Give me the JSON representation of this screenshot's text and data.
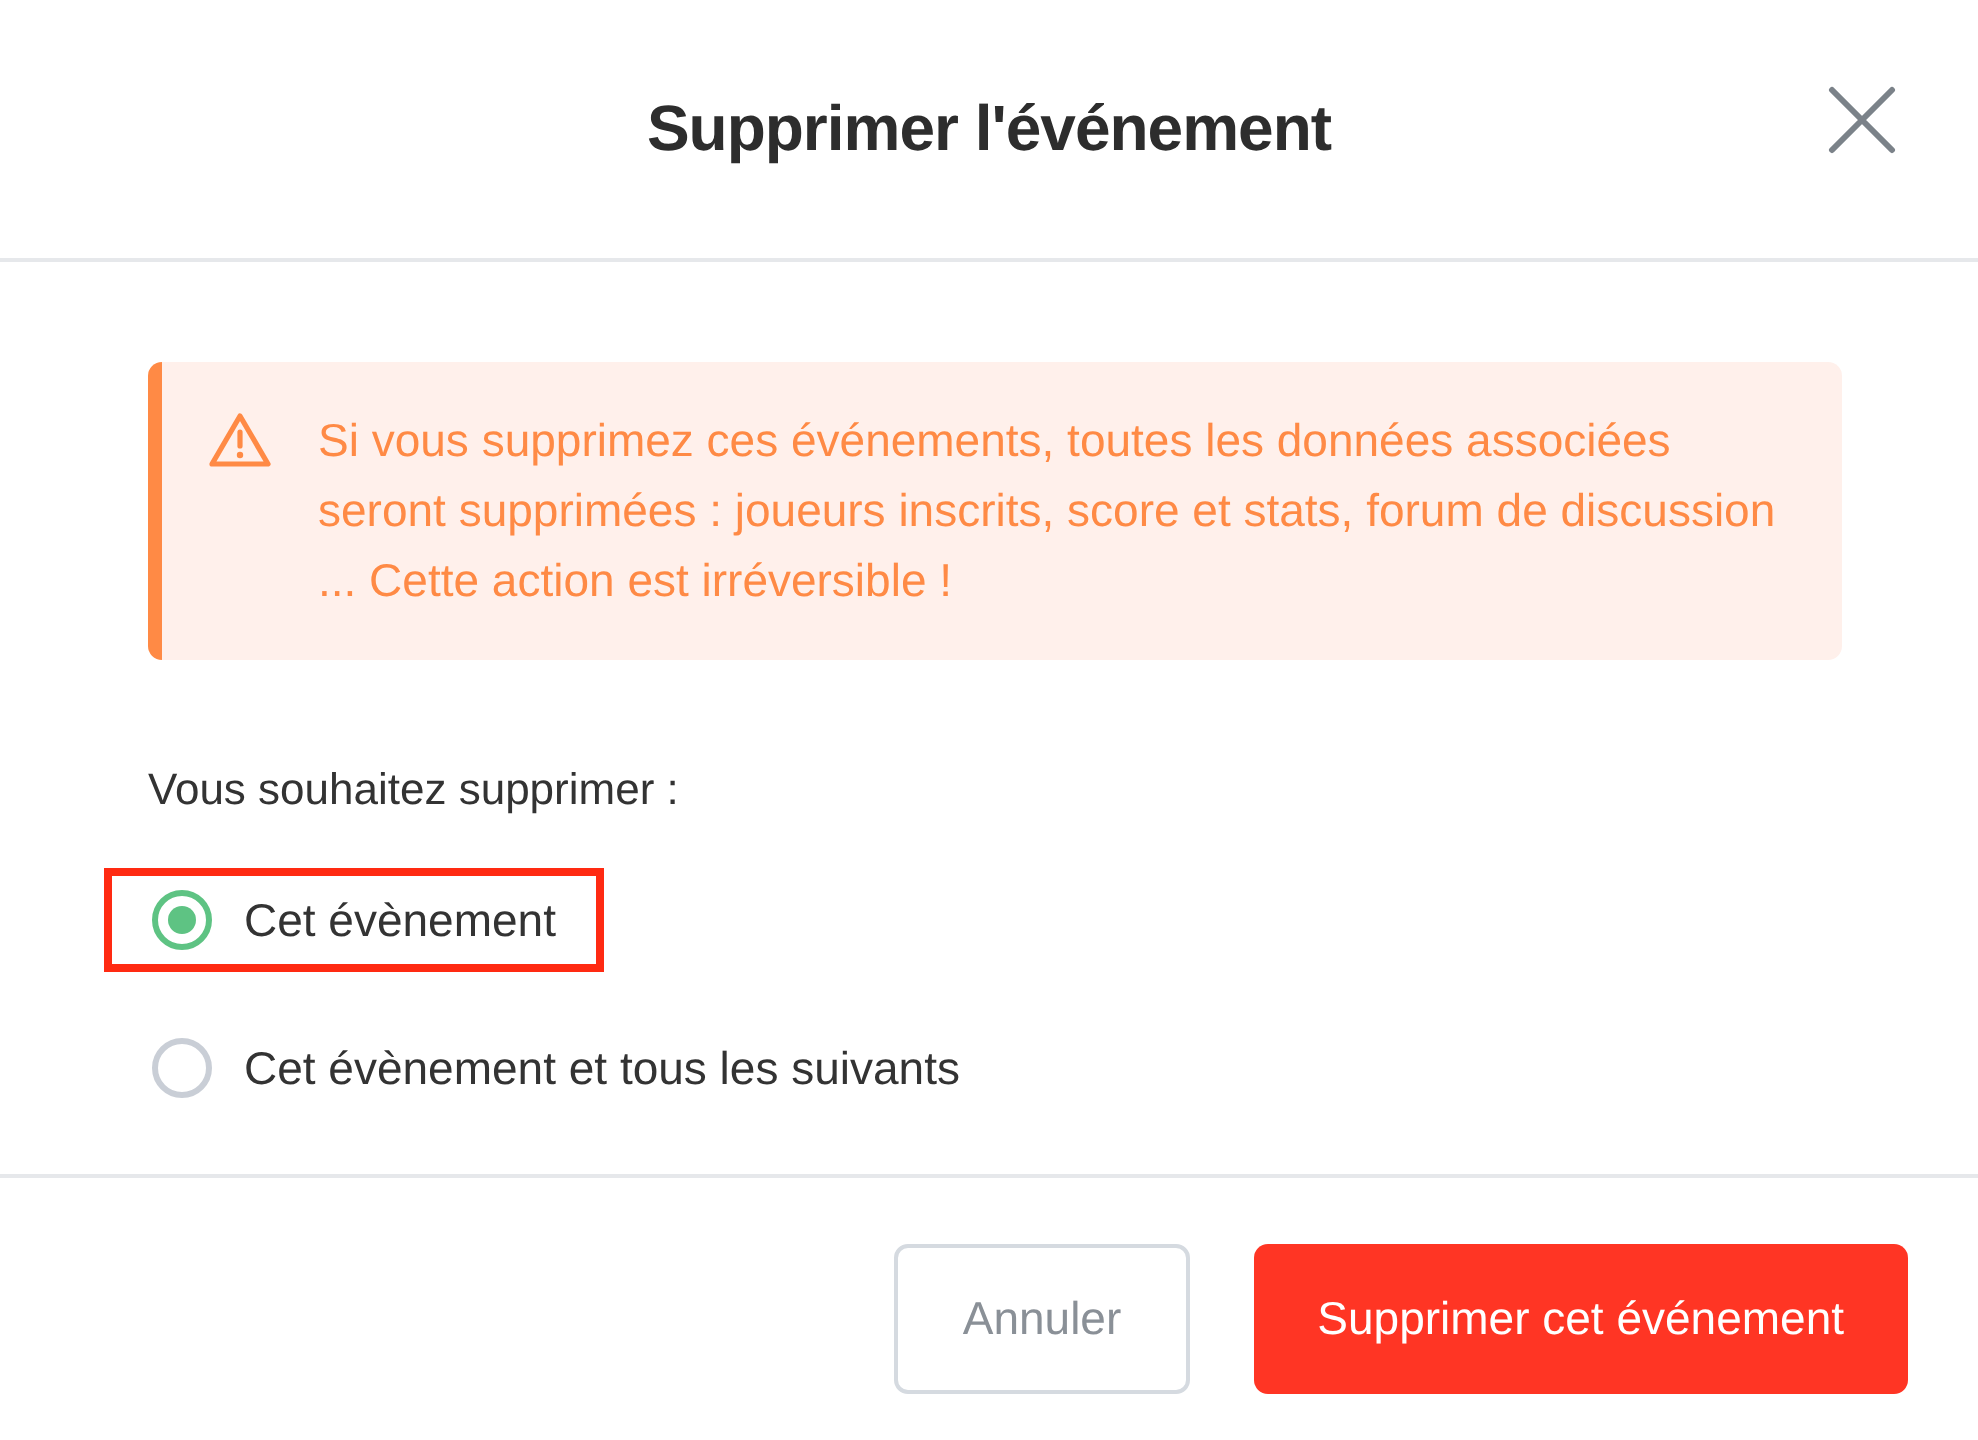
{
  "dialog": {
    "title": "Supprimer l'événement"
  },
  "warning": {
    "text": "Si vous supprimez ces événements, toutes les données associées seront supprimées : joueurs inscrits, score et stats, forum de discussion ... Cette action est irréversible !"
  },
  "question": "Vous souhaitez supprimer :",
  "options": [
    {
      "label": "Cet évènement",
      "selected": true,
      "highlighted": true
    },
    {
      "label": "Cet évènement et tous les suivants",
      "selected": false,
      "highlighted": false
    }
  ],
  "buttons": [
    {
      "kind": "secondary",
      "label": "Annuler"
    },
    {
      "kind": "danger",
      "label": "Supprimer cet événement"
    }
  ]
}
